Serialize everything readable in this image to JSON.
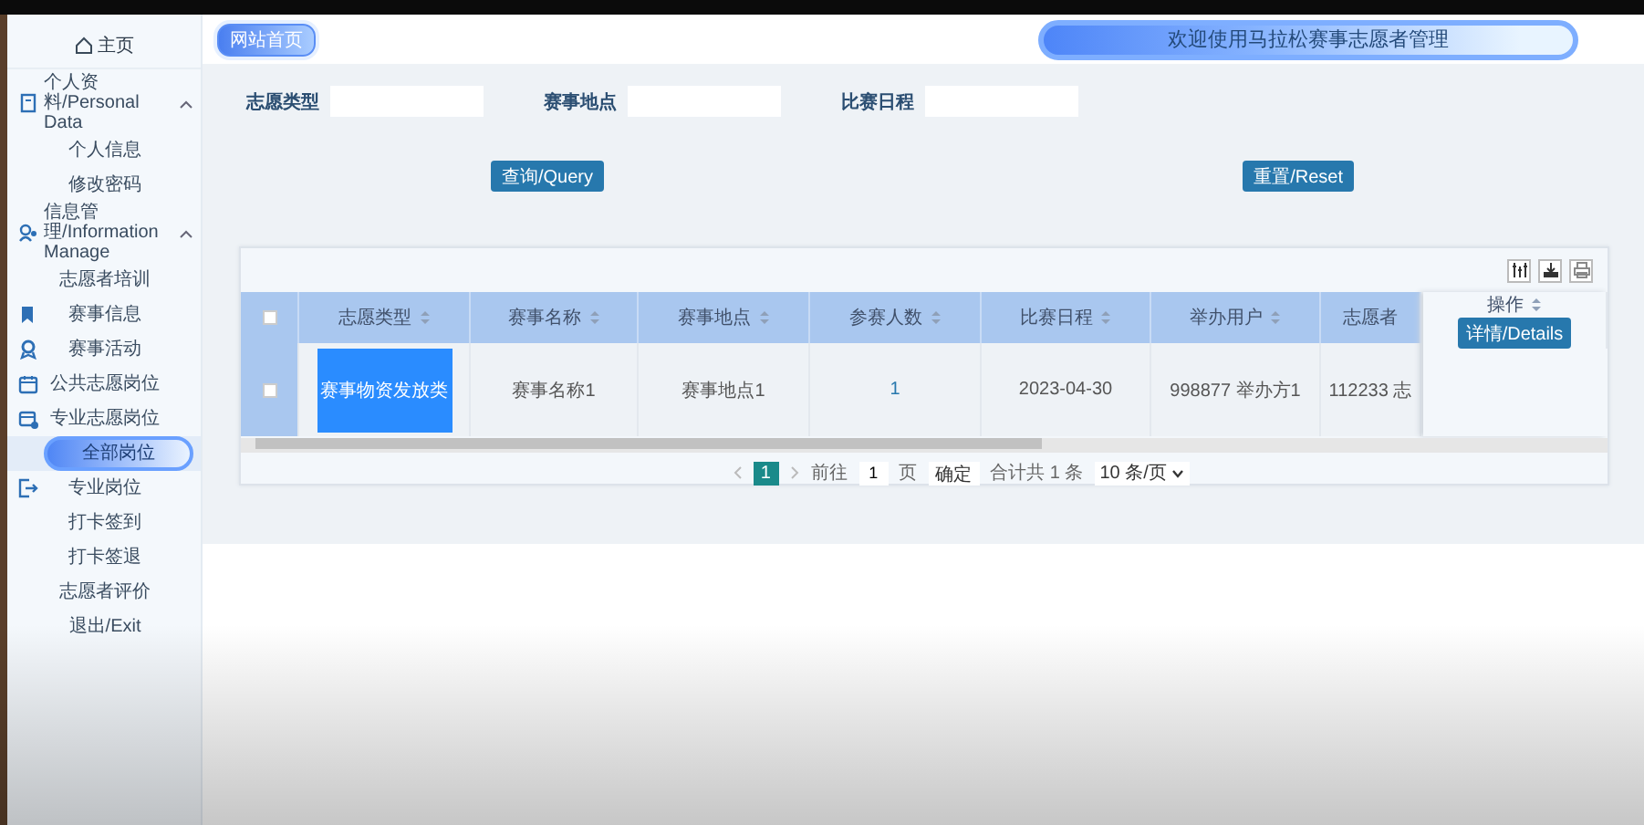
{
  "header": {
    "home_link": "网站首页",
    "banner": "欢迎使用马拉松赛事志愿者管理"
  },
  "sidebar": {
    "home": "主页",
    "items": [
      {
        "kind": "group",
        "label": "个人资料/Personal Data",
        "expanded": true
      },
      {
        "kind": "sub",
        "label": "个人信息",
        "selected": false
      },
      {
        "kind": "sub",
        "label": "修改密码",
        "selected": false
      },
      {
        "kind": "group",
        "label": "信息管理/Information Manage",
        "expanded": true
      },
      {
        "kind": "sub",
        "label": "志愿者培训",
        "selected": false
      },
      {
        "kind": "item",
        "label": "赛事信息",
        "selected": false
      },
      {
        "kind": "item",
        "label": "赛事活动",
        "selected": false
      },
      {
        "kind": "item",
        "label": "公共志愿岗位",
        "selected": false
      },
      {
        "kind": "item",
        "label": "专业志愿岗位",
        "selected": false
      },
      {
        "kind": "sub",
        "label": "全部岗位",
        "selected": true
      },
      {
        "kind": "item",
        "label": "专业岗位",
        "selected": false
      },
      {
        "kind": "sub",
        "label": "打卡签到",
        "selected": false
      },
      {
        "kind": "sub",
        "label": "打卡签退",
        "selected": false
      },
      {
        "kind": "sub",
        "label": "志愿者评价",
        "selected": false
      },
      {
        "kind": "sub",
        "label": "退出/Exit",
        "selected": false
      }
    ]
  },
  "search": {
    "fields": [
      {
        "label": "志愿类型"
      },
      {
        "label": "赛事地点"
      },
      {
        "label": "比赛日程"
      }
    ],
    "query_button": "查询/Query",
    "reset_button": "重置/Reset"
  },
  "table": {
    "all_checked": false,
    "columns": [
      "志愿类型",
      "赛事名称",
      "赛事地点",
      "参赛人数",
      "比赛日程",
      "举办用户",
      "志愿者"
    ],
    "action_column": "操作",
    "rows": [
      {
        "checked": false,
        "cells": [
          "赛事物资发放类",
          "赛事名称1",
          "赛事地点1",
          "1",
          "2023-04-30",
          "998877 举办方1",
          "112233 志"
        ],
        "action": "详情/Details"
      }
    ]
  },
  "pagination": {
    "current": "1",
    "goto_label": "前往",
    "goto_value": "1",
    "page_unit": "页",
    "confirm": "确定",
    "total": "合计共 1 条",
    "page_size": "10 条/页"
  }
}
